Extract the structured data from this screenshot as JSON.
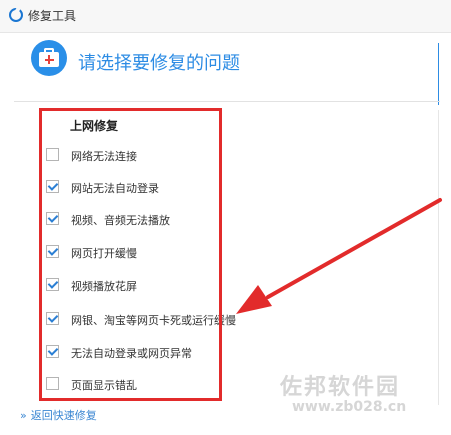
{
  "window": {
    "title": "修复工具",
    "accent": "#2d8ce4"
  },
  "header": {
    "heading": "请选择要修复的问题"
  },
  "section": {
    "title": "上网修复"
  },
  "items": [
    {
      "label": "网络无法连接",
      "checked": false
    },
    {
      "label": "网站无法自动登录",
      "checked": true
    },
    {
      "label": "视频、音频无法播放",
      "checked": true
    },
    {
      "label": "网页打开缓慢",
      "checked": true
    },
    {
      "label": "视频播放花屏",
      "checked": true
    },
    {
      "label": "网银、淘宝等网页卡死或运行缓慢",
      "checked": true
    },
    {
      "label": "无法自动登录或网页异常",
      "checked": true
    },
    {
      "label": "页面显示错乱",
      "checked": false
    }
  ],
  "footer": {
    "back_link": "返回快速修复"
  },
  "watermark": {
    "text": "佐邦软件园",
    "url": "www.zb028.cn"
  },
  "annotation": {
    "highlight_color": "#e22b2b"
  }
}
